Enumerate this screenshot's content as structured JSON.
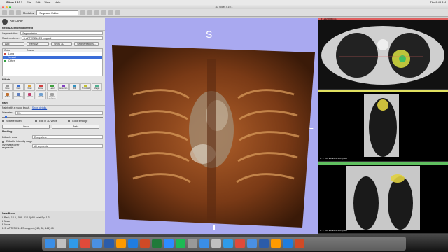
{
  "menubar": {
    "app": "Slicer 4.10.1",
    "items": [
      "File",
      "Edit",
      "View",
      "Help"
    ],
    "clock": "Thu 8:43 AM"
  },
  "window": {
    "title": "3D Slicer 4.10.1",
    "modules_label": "Modules:",
    "module_selected": "Segment Editor"
  },
  "left": {
    "logo": "3DSlicer",
    "help_section": "Help & Acknowledgement",
    "segmentation_label": "Segmentation:",
    "segmentation_value": "Segmentation",
    "master_label": "Master volume:",
    "master_value": "3: ARTERIELLES cropped",
    "add_label": "Add",
    "remove_label": "Remove",
    "show3d_label": "Show 3D",
    "segmentations_label": "Segmentations...",
    "table_headers": [
      "Color",
      "Name"
    ],
    "segments": [
      {
        "name": "Lung",
        "color": "#c8463c",
        "selected": false
      },
      {
        "name": "Vessel",
        "color": "#3c7ad6",
        "selected": true
      },
      {
        "name": "Other",
        "color": "#30a040",
        "selected": false
      }
    ],
    "effects_label": "Effects",
    "effects": [
      {
        "label": "None",
        "color": "#999999"
      },
      {
        "label": "Paint",
        "color": "#3a6fd0"
      },
      {
        "label": "Draw",
        "color": "#e0a030"
      },
      {
        "label": "Erase",
        "color": "#d04040"
      },
      {
        "label": "Level tracing",
        "color": "#40a040"
      },
      {
        "label": "Grow from seeds",
        "color": "#8040c0"
      },
      {
        "label": "Fill between slices",
        "color": "#3090c0"
      },
      {
        "label": "Threshold",
        "color": "#c0c030"
      },
      {
        "label": "Margin",
        "color": "#50b090"
      },
      {
        "label": "Hollow",
        "color": "#c07030"
      },
      {
        "label": "Smoothing",
        "color": "#6080c0"
      },
      {
        "label": "Scissors",
        "color": "#c04070"
      },
      {
        "label": "Islands",
        "color": "#70a0d0"
      },
      {
        "label": "Logical operators",
        "color": "#a0a0a0"
      }
    ],
    "paint_label": "Paint",
    "paint_desc": "Paint with a round brush.",
    "show_details": "Show details.",
    "diameter_label": "Diameter:",
    "diameter_value": "3%",
    "sphere_brush": "Sphere brush",
    "edit_3d": "Edit in 3D views",
    "color_smudge": "Color smudge",
    "undo_label": "Undo",
    "redo_label": "Redo",
    "masking_label": "Masking",
    "editable_area_label": "Editable area:",
    "editable_area_value": "Everywhere",
    "editable_intensity": "Editable intensity range",
    "overwrite_label": "Overwrite other segments:",
    "overwrite_value": "All segments",
    "dataprobe_label": "Data Probe",
    "probe_lines": [
      "L  Red    (-12.0, -5.8, -112.2)  AP    Axial Sp: 1.3",
      "L  None",
      "F  None",
      "B  3: ARTERIELLES cropped (118, 32, 144) 48"
    ]
  },
  "views": {
    "orient_S": "S",
    "orient_L": "L",
    "red_label": "R: -212.0000mm",
    "yellow_label": "B: 3: ARTERIELLES cropped",
    "green_label": "B: 3: ARTERIELLES cropped"
  },
  "colors": {
    "selection": "#3b6dd8",
    "render_bg": "#a9a9f0",
    "red_bar": "#e06060",
    "yellow_bar": "#e0e060",
    "green_bar": "#60c060"
  },
  "dock": {
    "icons": [
      "finder-icon",
      "launchpad-icon",
      "safari-icon",
      "chrome-icon",
      "mail-icon",
      "word-icon",
      "illustrator-icon",
      "photoshop-icon",
      "powerpoint-icon",
      "excel-icon",
      "zoom-icon",
      "spotify-icon",
      "trash-icon"
    ]
  }
}
